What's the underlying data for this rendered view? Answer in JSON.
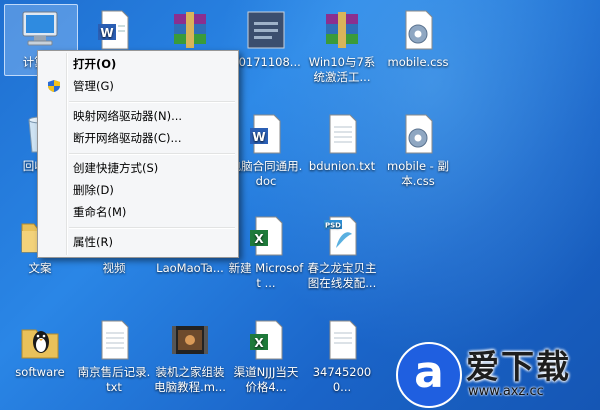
{
  "desktop": {
    "icons": [
      {
        "label": "计算机",
        "icon": "computer-icon"
      },
      {
        "label": "",
        "icon": "word-document-icon"
      },
      {
        "label": "",
        "icon": "rar-archive-icon"
      },
      {
        "label": "20171108...",
        "icon": "image-thumbnail-icon"
      },
      {
        "label": "Win10与7系统激活工...",
        "icon": "rar-archive-icon"
      },
      {
        "label": "mobile.css",
        "icon": "css-file-icon"
      },
      {
        "label": "回收站",
        "icon": "recycle-bin-icon"
      },
      {
        "label": "电脑合同通用.doc",
        "icon": "word-document-icon"
      },
      {
        "label": "bdunion.txt",
        "icon": "text-file-icon"
      },
      {
        "label": "mobile - 副本.css",
        "icon": "css-file-icon"
      },
      {
        "label": "文案",
        "icon": "folder-icon"
      },
      {
        "label": "视频",
        "icon": "folder-icon"
      },
      {
        "label": "LaoMaoTa...",
        "icon": "folder-icon"
      },
      {
        "label": "新建 Microsoft ...",
        "icon": "excel-file-icon"
      },
      {
        "label": "春之龙宝贝主图在线发配...",
        "icon": "psd-file-icon"
      },
      {
        "label": "software",
        "icon": "app-icon"
      },
      {
        "label": "南京售后记录.txt",
        "icon": "text-file-icon"
      },
      {
        "label": "装机之家组装电脑教程.m...",
        "icon": "video-file-icon"
      },
      {
        "label": "渠道NJJJ当天价格4...",
        "icon": "excel-file-icon"
      },
      {
        "label": "347452000...",
        "icon": "text-file-icon"
      }
    ]
  },
  "context_menu": {
    "items": [
      {
        "label": "打开(O)"
      },
      {
        "label": "管理(G)"
      },
      {
        "label": "映射网络驱动器(N)..."
      },
      {
        "label": "断开网络驱动器(C)..."
      },
      {
        "label": "创建快捷方式(S)"
      },
      {
        "label": "删除(D)"
      },
      {
        "label": "重命名(M)"
      },
      {
        "label": "属性(R)"
      }
    ]
  },
  "watermark": {
    "logo_char": "a",
    "brand": "爱下载",
    "url": "www.axz.cc"
  }
}
